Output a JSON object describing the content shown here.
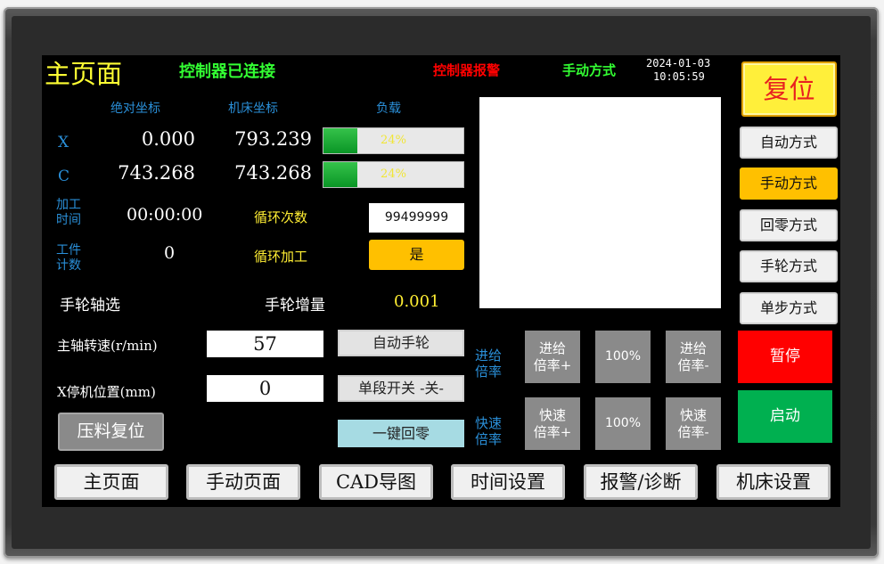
{
  "header": {
    "title": "主页面",
    "status_connected": "控制器已连接",
    "status_alarm": "控制器报警",
    "mode": "手动方式",
    "date": "2024-01-03",
    "time": "10:05:59",
    "reset_label": "复位"
  },
  "coords": {
    "col_abs": "绝对坐标",
    "col_machine": "机床坐标",
    "col_load": "负载",
    "rows": [
      {
        "axis": "X",
        "abs": "0.000",
        "machine": "793.239",
        "load_label": "24%",
        "load_fraction": 0.24
      },
      {
        "axis": "C",
        "abs": "743.268",
        "machine": "743.268",
        "load_label": "24%",
        "load_fraction": 0.24
      }
    ]
  },
  "info": {
    "proc_time_label_1": "加工",
    "proc_time_label_2": "时间",
    "proc_time": "00:00:00",
    "cycle_count_label": "循环次数",
    "cycle_count": "99499999",
    "part_count_label_1": "工件",
    "part_count_label_2": "计数",
    "part_count": "0",
    "cycle_proc_label": "循环加工",
    "cycle_proc_value": "是"
  },
  "handwheel": {
    "axis_select_label": "手轮轴选",
    "increment_label": "手轮增量",
    "increment": "0.001"
  },
  "params": {
    "spindle_label": "主轴转速(r/min)",
    "spindle_value": "57",
    "x_stop_label": "X停机位置(mm)",
    "x_stop_value": "0",
    "auto_handwheel": "自动手轮",
    "single_block": "单段开关 -关-",
    "one_key_home": "一键回零",
    "press_reset": "压料复位"
  },
  "overrides": {
    "feed_label_1": "进给",
    "feed_label_2": "倍率",
    "feed_plus_1": "进给",
    "feed_plus_2": "倍率+",
    "feed_value": "100%",
    "feed_minus_1": "进给",
    "feed_minus_2": "倍率-",
    "rapid_label_1": "快速",
    "rapid_label_2": "倍率",
    "rapid_plus_1": "快速",
    "rapid_plus_2": "倍率+",
    "rapid_value": "100%",
    "rapid_minus_1": "快速",
    "rapid_minus_2": "倍率-"
  },
  "modes": {
    "auto": "自动方式",
    "manual": "手动方式",
    "home": "回零方式",
    "handwheel": "手轮方式",
    "single": "单步方式",
    "pause": "暂停",
    "start": "启动"
  },
  "nav": {
    "main": "主页面",
    "manual": "手动页面",
    "cad": "CAD导图",
    "time": "时间设置",
    "alarm": "报警/诊断",
    "machine": "机床设置"
  },
  "colors": {
    "active_mode": "#ffc000",
    "alarm_text": "#ff0000",
    "connected_text": "#33ff33",
    "pause_bg": "#ff0000",
    "start_bg": "#00b050"
  }
}
